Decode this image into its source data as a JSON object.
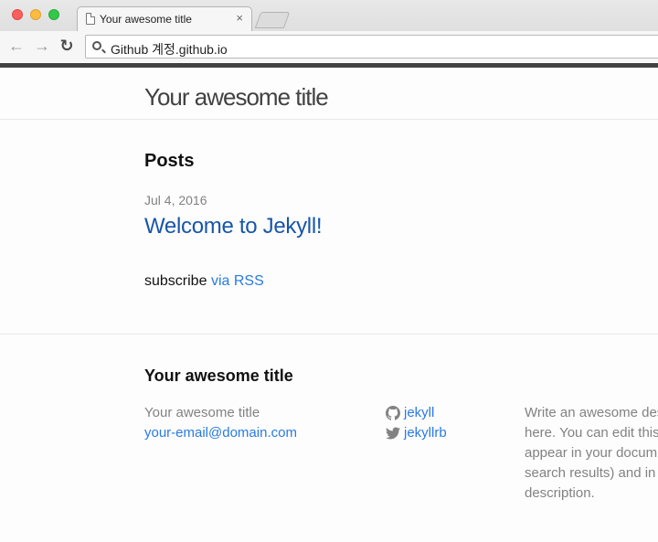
{
  "browser": {
    "tab_title": "Your awesome title",
    "tab_close": "×",
    "url": "Github 계정.github.io",
    "icons": {
      "back": "arrow-left-icon",
      "forward": "arrow-right-icon",
      "reload": "reload-icon",
      "search": "search-icon",
      "page": "document-icon"
    }
  },
  "site": {
    "title": "Your awesome title"
  },
  "posts": {
    "heading": "Posts",
    "items": [
      {
        "date": "Jul 4, 2016",
        "title": "Welcome to Jekyll!"
      }
    ],
    "subscribe_text": "subscribe",
    "rss_link": "via RSS"
  },
  "footer": {
    "heading": "Your awesome title",
    "name": "Your awesome title",
    "email": "your-email@domain.com",
    "social": [
      {
        "icon": "github-icon",
        "label": "jekyll"
      },
      {
        "icon": "twitter-icon",
        "label": "jekyllrb"
      }
    ],
    "description_lines": [
      "Write an awesome des",
      "here. You can edit this",
      "appear in your docum",
      "search results) and in",
      "description."
    ]
  },
  "colors": {
    "link": "#2a7ae2",
    "visited_link": "#1756a9",
    "meta_text": "#828282",
    "header_border": "#424242"
  }
}
